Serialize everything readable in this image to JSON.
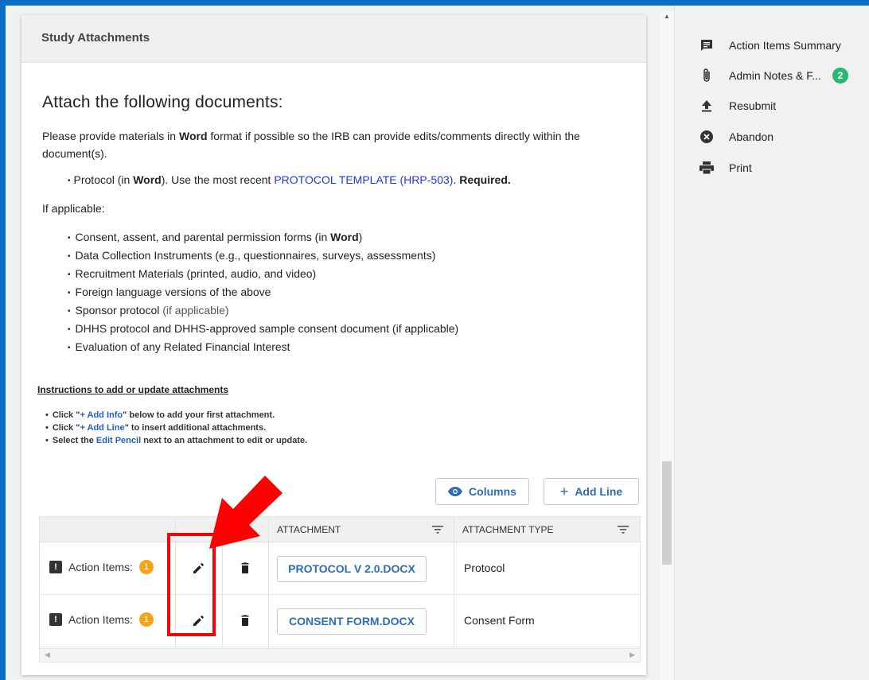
{
  "card": {
    "header": "Study Attachments",
    "heading": "Attach the following documents:",
    "intro_pre": "Please provide materials in ",
    "intro_word": "Word",
    "intro_post": " format if possible so the IRB can provide edits/comments directly within the document(s).",
    "protocol_pre": "Protocol (in ",
    "protocol_word": "Word",
    "protocol_mid": "). Use the most recent ",
    "protocol_link": "PROTOCOL TEMPLATE (HRP-503)",
    "protocol_dot": ". ",
    "protocol_required": "Required.",
    "applicable_label": "If applicable:",
    "doc_items": [
      "Consent, assent, and parental permission forms (in ",
      "Data Collection Instruments (e.g., questionnaires, surveys, assessments)",
      "Recruitment Materials (printed, audio, and video)",
      "Foreign language versions of the above",
      "Sponsor protocol ",
      "DHHS protocol and DHHS-approved sample consent document (if applicable)",
      "Evaluation of any Related Financial Interest"
    ],
    "doc_item0_word": "Word",
    "doc_item0_end": ")",
    "doc_item4_muted": "(if applicable)",
    "instructions_title": "Instructions to add or update attachments",
    "instr1_pre": "Click \"",
    "instr1_link": "+ Add Info",
    "instr1_post": "\" below to add your first attachment.",
    "instr2_pre": "Click \"",
    "instr2_link": "+ Add Line",
    "instr2_post": "\" to insert additional attachments.",
    "instr3_pre": "Select the ",
    "instr3_link": "Edit Pencil",
    "instr3_post": " next to an attachment to edit or update."
  },
  "toolbar": {
    "columns_label": "Columns",
    "add_line_label": "Add Line"
  },
  "table": {
    "headers": [
      "ATTACHMENT",
      "ATTACHMENT TYPE"
    ],
    "rows": [
      {
        "action_label": "Action Items:",
        "action_count": "1",
        "file": "PROTOCOL V 2.0.DOCX",
        "type": "Protocol"
      },
      {
        "action_label": "Action Items:",
        "action_count": "1",
        "file": "CONSENT FORM.DOCX",
        "type": "Consent Form"
      }
    ]
  },
  "sidebar": {
    "items": [
      {
        "label": "Action Items Summary",
        "icon": "comment-icon"
      },
      {
        "label": "Admin Notes & F...",
        "icon": "paperclip-icon",
        "badge": "2"
      },
      {
        "label": "Resubmit",
        "icon": "upload-icon"
      },
      {
        "label": "Abandon",
        "icon": "cancel-circle-icon"
      },
      {
        "label": "Print",
        "icon": "printer-icon"
      }
    ]
  },
  "colors": {
    "frame": "#0a6fc2",
    "link": "#1a39d6",
    "button_text": "#2d6db3",
    "orange_badge": "#f5a31a",
    "green_badge": "#2bb673",
    "highlight": "#ff0000"
  }
}
